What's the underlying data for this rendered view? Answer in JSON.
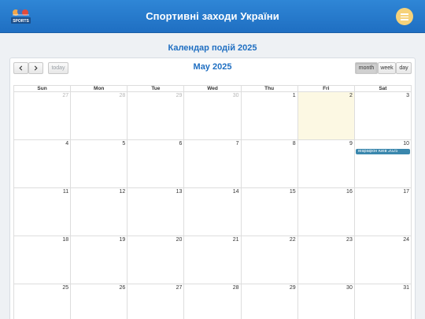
{
  "header": {
    "title": "Спортивні заходи України",
    "logo_text": "SPORTS",
    "logo_icon": "sports-logo-icon",
    "menu_icon": "menu-icon"
  },
  "section": {
    "title": "Календар подій 2025"
  },
  "toolbar": {
    "prev_icon": "chevron-left-icon",
    "next_icon": "chevron-right-icon",
    "today_label": "today",
    "month_title": "May 2025",
    "views": [
      "month",
      "week",
      "day"
    ],
    "active_view": "month"
  },
  "calendar": {
    "weekdays": [
      "Sun",
      "Mon",
      "Tue",
      "Wed",
      "Thu",
      "Fri",
      "Sat"
    ],
    "weeks": [
      [
        {
          "n": "27",
          "other": true
        },
        {
          "n": "28",
          "other": true
        },
        {
          "n": "29",
          "other": true
        },
        {
          "n": "30",
          "other": true
        },
        {
          "n": "1"
        },
        {
          "n": "2",
          "today": true
        },
        {
          "n": "3"
        }
      ],
      [
        {
          "n": "4"
        },
        {
          "n": "5"
        },
        {
          "n": "6"
        },
        {
          "n": "7"
        },
        {
          "n": "8"
        },
        {
          "n": "9"
        },
        {
          "n": "10",
          "event": "Марафон Київ 2025"
        }
      ],
      [
        {
          "n": "11"
        },
        {
          "n": "12"
        },
        {
          "n": "13"
        },
        {
          "n": "14"
        },
        {
          "n": "15"
        },
        {
          "n": "16"
        },
        {
          "n": "17"
        }
      ],
      [
        {
          "n": "18"
        },
        {
          "n": "19"
        },
        {
          "n": "20"
        },
        {
          "n": "21"
        },
        {
          "n": "22"
        },
        {
          "n": "23"
        },
        {
          "n": "24"
        }
      ],
      [
        {
          "n": "25"
        },
        {
          "n": "26"
        },
        {
          "n": "27"
        },
        {
          "n": "28"
        },
        {
          "n": "29"
        },
        {
          "n": "30"
        },
        {
          "n": "31"
        }
      ]
    ]
  },
  "colors": {
    "header": "#1f6fc2",
    "accent": "#1f6fc2",
    "menu_button": "#f6d27a",
    "today_bg": "#fcf8e3",
    "event_bg": "#3a87ad"
  }
}
